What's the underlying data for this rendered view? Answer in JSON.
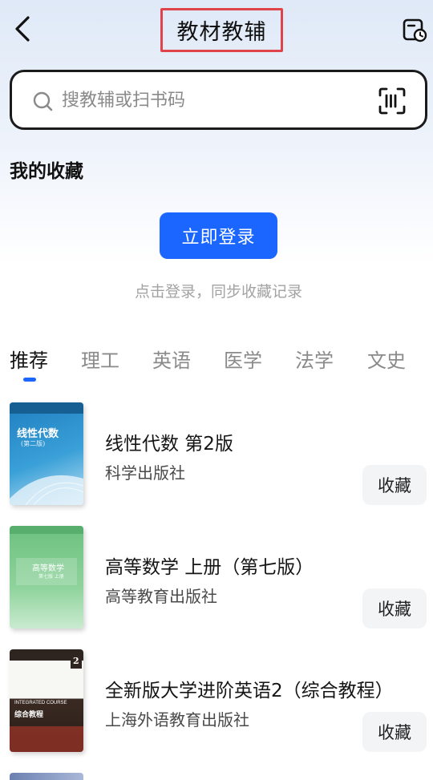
{
  "header": {
    "title": "教材教辅"
  },
  "search": {
    "placeholder": "搜教辅或扫书码"
  },
  "favorites": {
    "title": "我的收藏",
    "login_label": "立即登录",
    "hint": "点击登录，同步收藏记录"
  },
  "tabs": [
    {
      "label": "推荐",
      "active": true
    },
    {
      "label": "理工",
      "active": false
    },
    {
      "label": "英语",
      "active": false
    },
    {
      "label": "医学",
      "active": false
    },
    {
      "label": "法学",
      "active": false
    },
    {
      "label": "文史",
      "active": false
    }
  ],
  "books": [
    {
      "title": "线性代数 第2版",
      "publisher": "科学出版社",
      "fav_label": "收藏",
      "cover": {
        "title": "线性代数",
        "edition": "(第二版)",
        "color": "#2b8fc9"
      }
    },
    {
      "title": "高等数学 上册（第七版）",
      "publisher": "高等教育出版社",
      "fav_label": "收藏",
      "cover": {
        "title": "高等数学",
        "edition": "第七版 上册",
        "color": "#7dc98c"
      }
    },
    {
      "title": "全新版大学进阶英语2（综合教程）",
      "publisher": "上海外语教育出版社",
      "fav_label": "收藏",
      "cover": {
        "title": "综合教程",
        "subtitle": "INTEGRATED COURSE",
        "number": "2",
        "color": "#3a2a22"
      }
    }
  ],
  "colors": {
    "accent": "#1a66ff",
    "highlight_border": "#e0444a"
  }
}
